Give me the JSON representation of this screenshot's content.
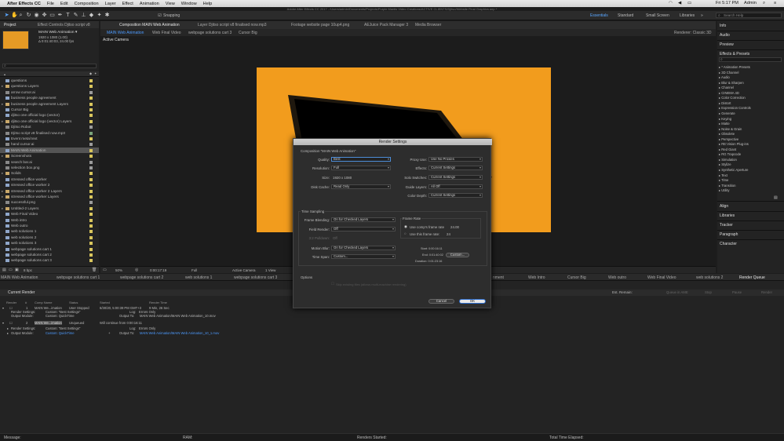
{
  "menubar": {
    "apple": "",
    "app": "After Effects CC",
    "menus": [
      "File",
      "Edit",
      "Composition",
      "Layer",
      "Effect",
      "Animation",
      "View",
      "Window",
      "Help"
    ],
    "time": "Fri 5:17 PM",
    "user": "Admin"
  },
  "window_title": "Adobe After Effects CC 2017 - /Users/admin/Documents/Projects/Purple Mantis Video Creations/ACTIVE CLIENTS/Djitso/Website Final Graphics.aep *",
  "toolbar": {
    "snapping": "Snapping",
    "workspaces": [
      "Essentials",
      "Standard",
      "Small Screen",
      "Libraries"
    ],
    "active_workspace": "Essentials",
    "search_placeholder": "Search Help"
  },
  "project": {
    "tabs": [
      "Project",
      "Effect Controls Djitso script v8"
    ],
    "selected_name": "MAIN Web Animation ▾",
    "selected_info": [
      "1920 x 1080 (1.00)",
      "Δ 0:01:40:03, 24.00 fps"
    ],
    "search_placeholder": "",
    "items": [
      {
        "name": "questions",
        "type": "comp",
        "label": "#d9c65d",
        "expand": ""
      },
      {
        "name": "questions Layers",
        "type": "folder",
        "label": "#d9c65d",
        "expand": "▸"
      },
      {
        "name": "arrow cursor.ai",
        "type": "file",
        "label": "#9c9c9c",
        "expand": ""
      },
      {
        "name": "business people agreement",
        "type": "comp",
        "label": "#d9c65d",
        "expand": ""
      },
      {
        "name": "business people agreement Layers",
        "type": "folder",
        "label": "#d9c65d",
        "expand": "▸"
      },
      {
        "name": "Cursor Big",
        "type": "comp",
        "label": "#d9c65d",
        "expand": ""
      },
      {
        "name": "djitso one official logo (vector)",
        "type": "comp",
        "label": "#d9c65d",
        "expand": ""
      },
      {
        "name": "djitso one official logo (vector) Layers",
        "type": "folder",
        "label": "#d9c65d",
        "expand": "▸"
      },
      {
        "name": "Djitso Robot",
        "type": "file",
        "label": "#9c9c9c",
        "expand": ""
      },
      {
        "name": "Djitso script v8 finalised now.mp3",
        "type": "file",
        "label": "#7aa37a",
        "expand": ""
      },
      {
        "name": "Event metal text",
        "type": "comp",
        "label": "#d9c65d",
        "expand": ""
      },
      {
        "name": "hand cursor.ai",
        "type": "file",
        "label": "#9c9c9c",
        "expand": ""
      },
      {
        "name": "MAIN Web Animation",
        "type": "comp",
        "label": "#d9c65d",
        "expand": "",
        "selected": true
      },
      {
        "name": "Screenshots",
        "type": "folder",
        "label": "#d9c65d",
        "expand": "▸"
      },
      {
        "name": "search bar.ai",
        "type": "file",
        "label": "#9c9c9c",
        "expand": ""
      },
      {
        "name": "selection box.png",
        "type": "file",
        "label": "#9c9c9c",
        "expand": ""
      },
      {
        "name": "Solids",
        "type": "folder",
        "label": "#d9c65d",
        "expand": "▸"
      },
      {
        "name": "stressed office worker",
        "type": "comp",
        "label": "#d9c65d",
        "expand": ""
      },
      {
        "name": "stressed office worker 2",
        "type": "comp",
        "label": "#d9c65d",
        "expand": ""
      },
      {
        "name": "stressed office worker 2 Layers",
        "type": "folder",
        "label": "#d9c65d",
        "expand": "▸"
      },
      {
        "name": "stressed office worker Layers",
        "type": "folder",
        "label": "#d9c65d",
        "expand": "▸"
      },
      {
        "name": "successful.png",
        "type": "file",
        "label": "#9c9c9c",
        "expand": ""
      },
      {
        "name": "Untitled-2 Layers",
        "type": "folder",
        "label": "#d9c65d",
        "expand": "▸"
      },
      {
        "name": "Web Final Video",
        "type": "comp",
        "label": "#d9c65d",
        "expand": ""
      },
      {
        "name": "Web intro",
        "type": "comp",
        "label": "#d9c65d",
        "expand": ""
      },
      {
        "name": "Web outro",
        "type": "comp",
        "label": "#d9c65d",
        "expand": ""
      },
      {
        "name": "web solutions 1",
        "type": "comp",
        "label": "#d9c65d",
        "expand": ""
      },
      {
        "name": "web solutions 2",
        "type": "comp",
        "label": "#d9c65d",
        "expand": ""
      },
      {
        "name": "web solutions 3",
        "type": "comp",
        "label": "#d9c65d",
        "expand": ""
      },
      {
        "name": "webpage solutions cart 1",
        "type": "comp",
        "label": "#d9c65d",
        "expand": ""
      },
      {
        "name": "webpage solutions cart 2",
        "type": "comp",
        "label": "#d9c65d",
        "expand": ""
      },
      {
        "name": "webpage solutions cart 3",
        "type": "comp",
        "label": "#d9c65d",
        "expand": ""
      }
    ],
    "footer_bpc": "8 bpc"
  },
  "composition": {
    "tabs": [
      "Composition MAIN Web Animation",
      "Layer Djitso script v8 finalised now.mp3",
      "Footage website page 10up4.png",
      "AEJuice Pack Manager 3",
      "Media Browser"
    ],
    "subtabs": [
      "MAIN Web Animation",
      "Web Final Video",
      "webpage solutions cart 3",
      "Cursor Big"
    ],
    "renderer": "Renderer: Classic 3D",
    "active_camera": "Active Camera",
    "footer": {
      "zoom": "50%",
      "timecode": "0:00:17:19",
      "resolution": "Full",
      "camera": "Active Camera",
      "view": "1 View"
    }
  },
  "right_panels": {
    "top": [
      "Info",
      "Audio",
      "Preview"
    ],
    "effects_title": "Effects & Presets",
    "effects": [
      "* Animation Presets",
      "3D Channel",
      "Audio",
      "Blur & Sharpen",
      "Channel",
      "CINEMA 4D",
      "Color Correction",
      "Distort",
      "Expression Controls",
      "Generate",
      "Keying",
      "Matte",
      "Noise & Grain",
      "Obsolete",
      "Perspective",
      "RE:Vision Plug-ins",
      "Red Giant",
      "RG Trapcode",
      "Simulation",
      "Stylize",
      "Synthetic Aperture",
      "Text",
      "Time",
      "Transition",
      "Utility"
    ],
    "bottom": [
      "Align",
      "Libraries",
      "Tracker",
      "Paragraph",
      "Character"
    ]
  },
  "timeline": {
    "tabs": [
      "MAIN Web Animation",
      "webpage solutions cart 1",
      "webpage solutions cart 2",
      "web solutions 1",
      "webpage solutions cart 3",
      "nment",
      "Web Intro",
      "Cursor Big",
      "Web outro",
      "Web Final Video",
      "web solutions 2",
      "Render Queue"
    ],
    "current_render": "Current Render",
    "est_remain": "Est. Remain:",
    "rq_buttons": [
      "Queue in AME",
      "Stop",
      "Pause",
      "Render"
    ],
    "columns": [
      "Render",
      "#",
      "Comp Name",
      "Status",
      "Started",
      "Render Time"
    ],
    "items": [
      {
        "num": "1",
        "comp": "MAIN We...imation",
        "status": "User Stopped",
        "started": "6/30/20, 5:00:39 PM GMT+3",
        "render_time": "9 Min, 26 Sec",
        "render_settings": "Custom: \"Best Settings\"",
        "log": "Errors Only",
        "output_module": "Custom: QuickTime",
        "output_to": "MAIN Web Animation/MAIN Web Animation_10.mov"
      },
      {
        "num": "2",
        "comp": "MAIN We...imation",
        "status": "Unqueued",
        "started": "Will continue from 0:00:16:11",
        "render_time": "",
        "render_settings": "Custom: \"Best Settings\"",
        "log": "Errors Only",
        "output_module": "Custom: QuickTime",
        "output_to": "MAIN Web Animation/MAIN Web Animation_10_1.mov"
      }
    ],
    "labels": {
      "render_settings": "Render Settings:",
      "output_module": "Output Module:",
      "log": "Log:",
      "output_to": "Output To:"
    }
  },
  "statusbar": {
    "message": "Message:",
    "ram": "RAM:",
    "renders_started": "Renders Started:",
    "total_time": "Total Time Elapsed:"
  },
  "render_settings": {
    "title": "Render Settings",
    "composition": "Composition \"MAIN Web Animation\"",
    "quality_label": "Quality:",
    "quality": "Best",
    "resolution_label": "Resolution:",
    "resolution": "Full",
    "size_label": "Size:",
    "size": "1920 x 1080",
    "disk_cache_label": "Disk Cache:",
    "disk_cache": "Read Only",
    "proxy_label": "Proxy Use:",
    "proxy": "Use No Proxies",
    "effects_label": "Effects:",
    "effects": "Current Settings",
    "solo_label": "Solo Switches:",
    "solo": "Current Settings",
    "guide_label": "Guide Layers:",
    "guide": "All Off",
    "color_depth_label": "Color Depth:",
    "color_depth": "Current Settings",
    "time_sampling": "Time Sampling",
    "frame_blending_label": "Frame Blending:",
    "frame_blending": "On for Checked Layers",
    "field_render_label": "Field Render:",
    "field_render": "Off",
    "pulldown_label": "3:2 Pulldown:",
    "pulldown": "Off",
    "motion_blur_label": "Motion Blur:",
    "motion_blur": "On for Checked Layers",
    "time_span_label": "Time Span:",
    "time_span": "Custom...",
    "frame_rate": "Frame Rate",
    "use_comp_rate": "Use comp's frame rate",
    "comp_rate_value": "24.00",
    "use_this_rate": "Use this frame rate:",
    "this_rate_value": "24",
    "start": "Start: 0:00:16:11",
    "end": "End: 0:01:40:02",
    "duration": "Duration: 0:01:23:16",
    "custom_button": "Custom...",
    "options": "Options",
    "skip_existing": "Skip existing files (allows multi-machine rendering)",
    "cancel": "Cancel",
    "ok": "OK"
  },
  "colors": {
    "accent": "#4d9bff",
    "canvas": "#f29c1d"
  }
}
